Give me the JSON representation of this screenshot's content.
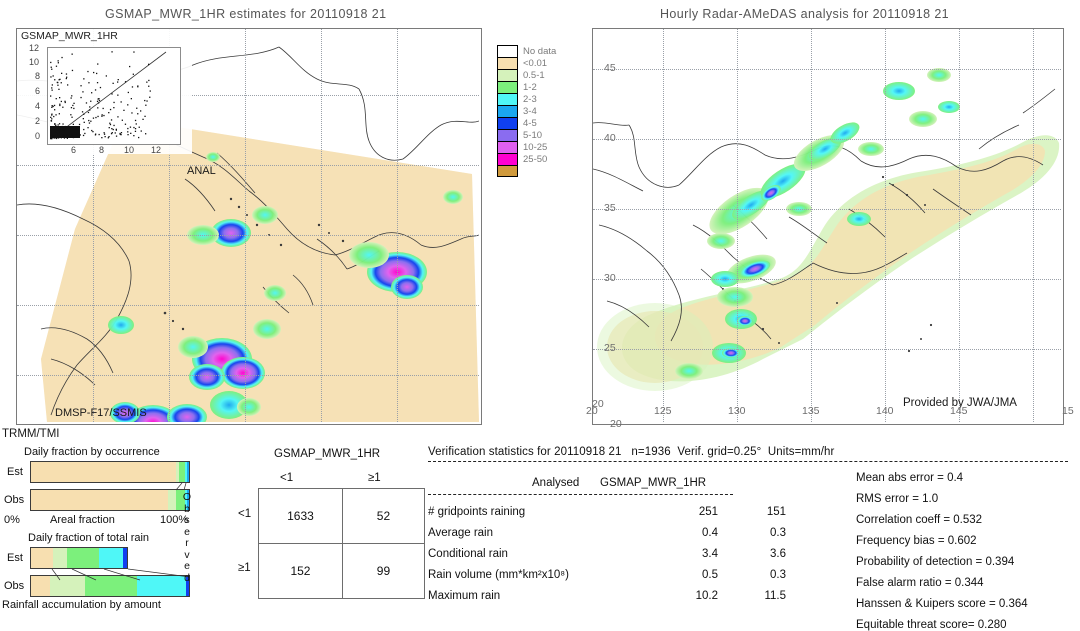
{
  "panels": {
    "left": {
      "title": "GSMAP_MWR_1HR estimates for 20110918 21",
      "inset_title": "GSMAP_MWR_1HR",
      "inset_y_ticks": [
        "12",
        "10",
        "8",
        "6",
        "4",
        "2",
        "0"
      ],
      "inset_x_ticks": [
        "6",
        "8",
        "10",
        "12"
      ],
      "anal_label": "ANAL",
      "sensor_label": "DMSP-F17/SSMIS",
      "sensor_label2": "TRMM/TMI"
    },
    "right": {
      "title": "Hourly Radar-AMeDAS analysis for 20110918 21",
      "x_ticks": [
        "20",
        "125",
        "130",
        "135",
        "140",
        "145",
        "15"
      ],
      "y_ticks": [
        "45",
        "40",
        "35",
        "30",
        "25",
        "20"
      ],
      "credit": "Provided by JWA/JMA"
    }
  },
  "colorbar": {
    "entries": [
      {
        "label": "No data",
        "color": "#ffffff"
      },
      {
        "label": "<0.01",
        "color": "#f7dfb0"
      },
      {
        "label": "0.5-1",
        "color": "#d5f2bb"
      },
      {
        "label": "1-2",
        "color": "#7cf07c"
      },
      {
        "label": "2-3",
        "color": "#4ff7f7"
      },
      {
        "label": "3-4",
        "color": "#1aa7f0"
      },
      {
        "label": "4-5",
        "color": "#1040f0"
      },
      {
        "label": "5-10",
        "color": "#8a6cf0"
      },
      {
        "label": "10-25",
        "color": "#e060f0"
      },
      {
        "label": "25-50",
        "color": "#ff00d0"
      },
      {
        "label": "",
        "color": "#d09a3c"
      }
    ]
  },
  "fraction_charts": {
    "occurrence": {
      "title": "Daily fraction by occurrence",
      "xlabel": "Areal fraction",
      "x_min_label": "0%",
      "x_max_label": "100%",
      "rows": [
        {
          "label": "Est",
          "segments": [
            {
              "color": "#f7dfb0",
              "pct": 91.5
            },
            {
              "color": "#d5f2bb",
              "pct": 2.0
            },
            {
              "color": "#7cf07c",
              "pct": 4.0
            },
            {
              "color": "#4ff7f7",
              "pct": 1.5
            },
            {
              "color": "#1aa7f0",
              "pct": 1.0
            }
          ]
        },
        {
          "label": "Obs",
          "segments": [
            {
              "color": "#f7dfb0",
              "pct": 87.0
            },
            {
              "color": "#d5f2bb",
              "pct": 4.5
            },
            {
              "color": "#7cf07c",
              "pct": 6.0
            },
            {
              "color": "#4ff7f7",
              "pct": 1.5
            },
            {
              "color": "#1aa7f0",
              "pct": 1.0
            }
          ]
        }
      ]
    },
    "total_rain": {
      "title": "Daily fraction of total rain",
      "xlabel": "Rainfall accumulation by amount",
      "rows": [
        {
          "label": "Est",
          "width_pct": 61,
          "segments": [
            {
              "color": "#f7dfb0",
              "pct": 23
            },
            {
              "color": "#d5f2bb",
              "pct": 14
            },
            {
              "color": "#7cf07c",
              "pct": 34
            },
            {
              "color": "#4ff7f7",
              "pct": 25
            },
            {
              "color": "#1040f0",
              "pct": 4
            }
          ]
        },
        {
          "label": "Obs",
          "width_pct": 100,
          "segments": [
            {
              "color": "#f7dfb0",
              "pct": 12
            },
            {
              "color": "#d5f2bb",
              "pct": 22
            },
            {
              "color": "#7cf07c",
              "pct": 33
            },
            {
              "color": "#4ff7f7",
              "pct": 31
            },
            {
              "color": "#1040f0",
              "pct": 2
            }
          ]
        }
      ]
    }
  },
  "chart_data": {
    "type": "table",
    "title": "Verification statistics for 20110918 21",
    "contingency": {
      "column_header": "GSMAP_MWR_1HR",
      "row_header": "Observed",
      "col_labels": [
        "<1",
        "≥1"
      ],
      "row_labels": [
        "<1",
        "≥1"
      ],
      "cells": [
        [
          1633,
          52
        ],
        [
          152,
          99
        ]
      ]
    },
    "verification_header": "Verification statistics for 20110918 21   n=1936  Verif. grid=0.25°  Units=mm/hr",
    "divider": "––––––––––––––––––––––––––––––––––––––––––––––––––––––––––––––",
    "stats_table": {
      "col_headers": [
        "Analysed",
        "GSMAP_MWR_1HR"
      ],
      "divider": "––––––––––––––––––––––––––––––––––",
      "rows": [
        {
          "name": "# gridpoints raining",
          "analysed": "251",
          "model": "151"
        },
        {
          "name": "Average rain",
          "analysed": "0.4",
          "model": "0.3"
        },
        {
          "name": "Conditional rain",
          "analysed": "3.4",
          "model": "3.6"
        },
        {
          "name": "Rain volume (mm*km²x10⁸)",
          "analysed": "0.5",
          "model": "0.3"
        },
        {
          "name": "Maximum rain",
          "analysed": "10.2",
          "model": "11.5"
        }
      ]
    },
    "scores": [
      {
        "label": "Mean abs error",
        "value": "0.4"
      },
      {
        "label": "RMS error",
        "value": "1.0"
      },
      {
        "label": "Correlation coeff",
        "value": "0.532"
      },
      {
        "label": "Frequency bias",
        "value": "0.602"
      },
      {
        "label": "Probability of detection",
        "value": "0.394"
      },
      {
        "label": "False alarm ratio",
        "value": "0.344"
      },
      {
        "label": "Hanssen & Kuipers score",
        "value": "0.364"
      },
      {
        "label": "Equitable threat score=",
        "value": "0.280"
      }
    ]
  }
}
